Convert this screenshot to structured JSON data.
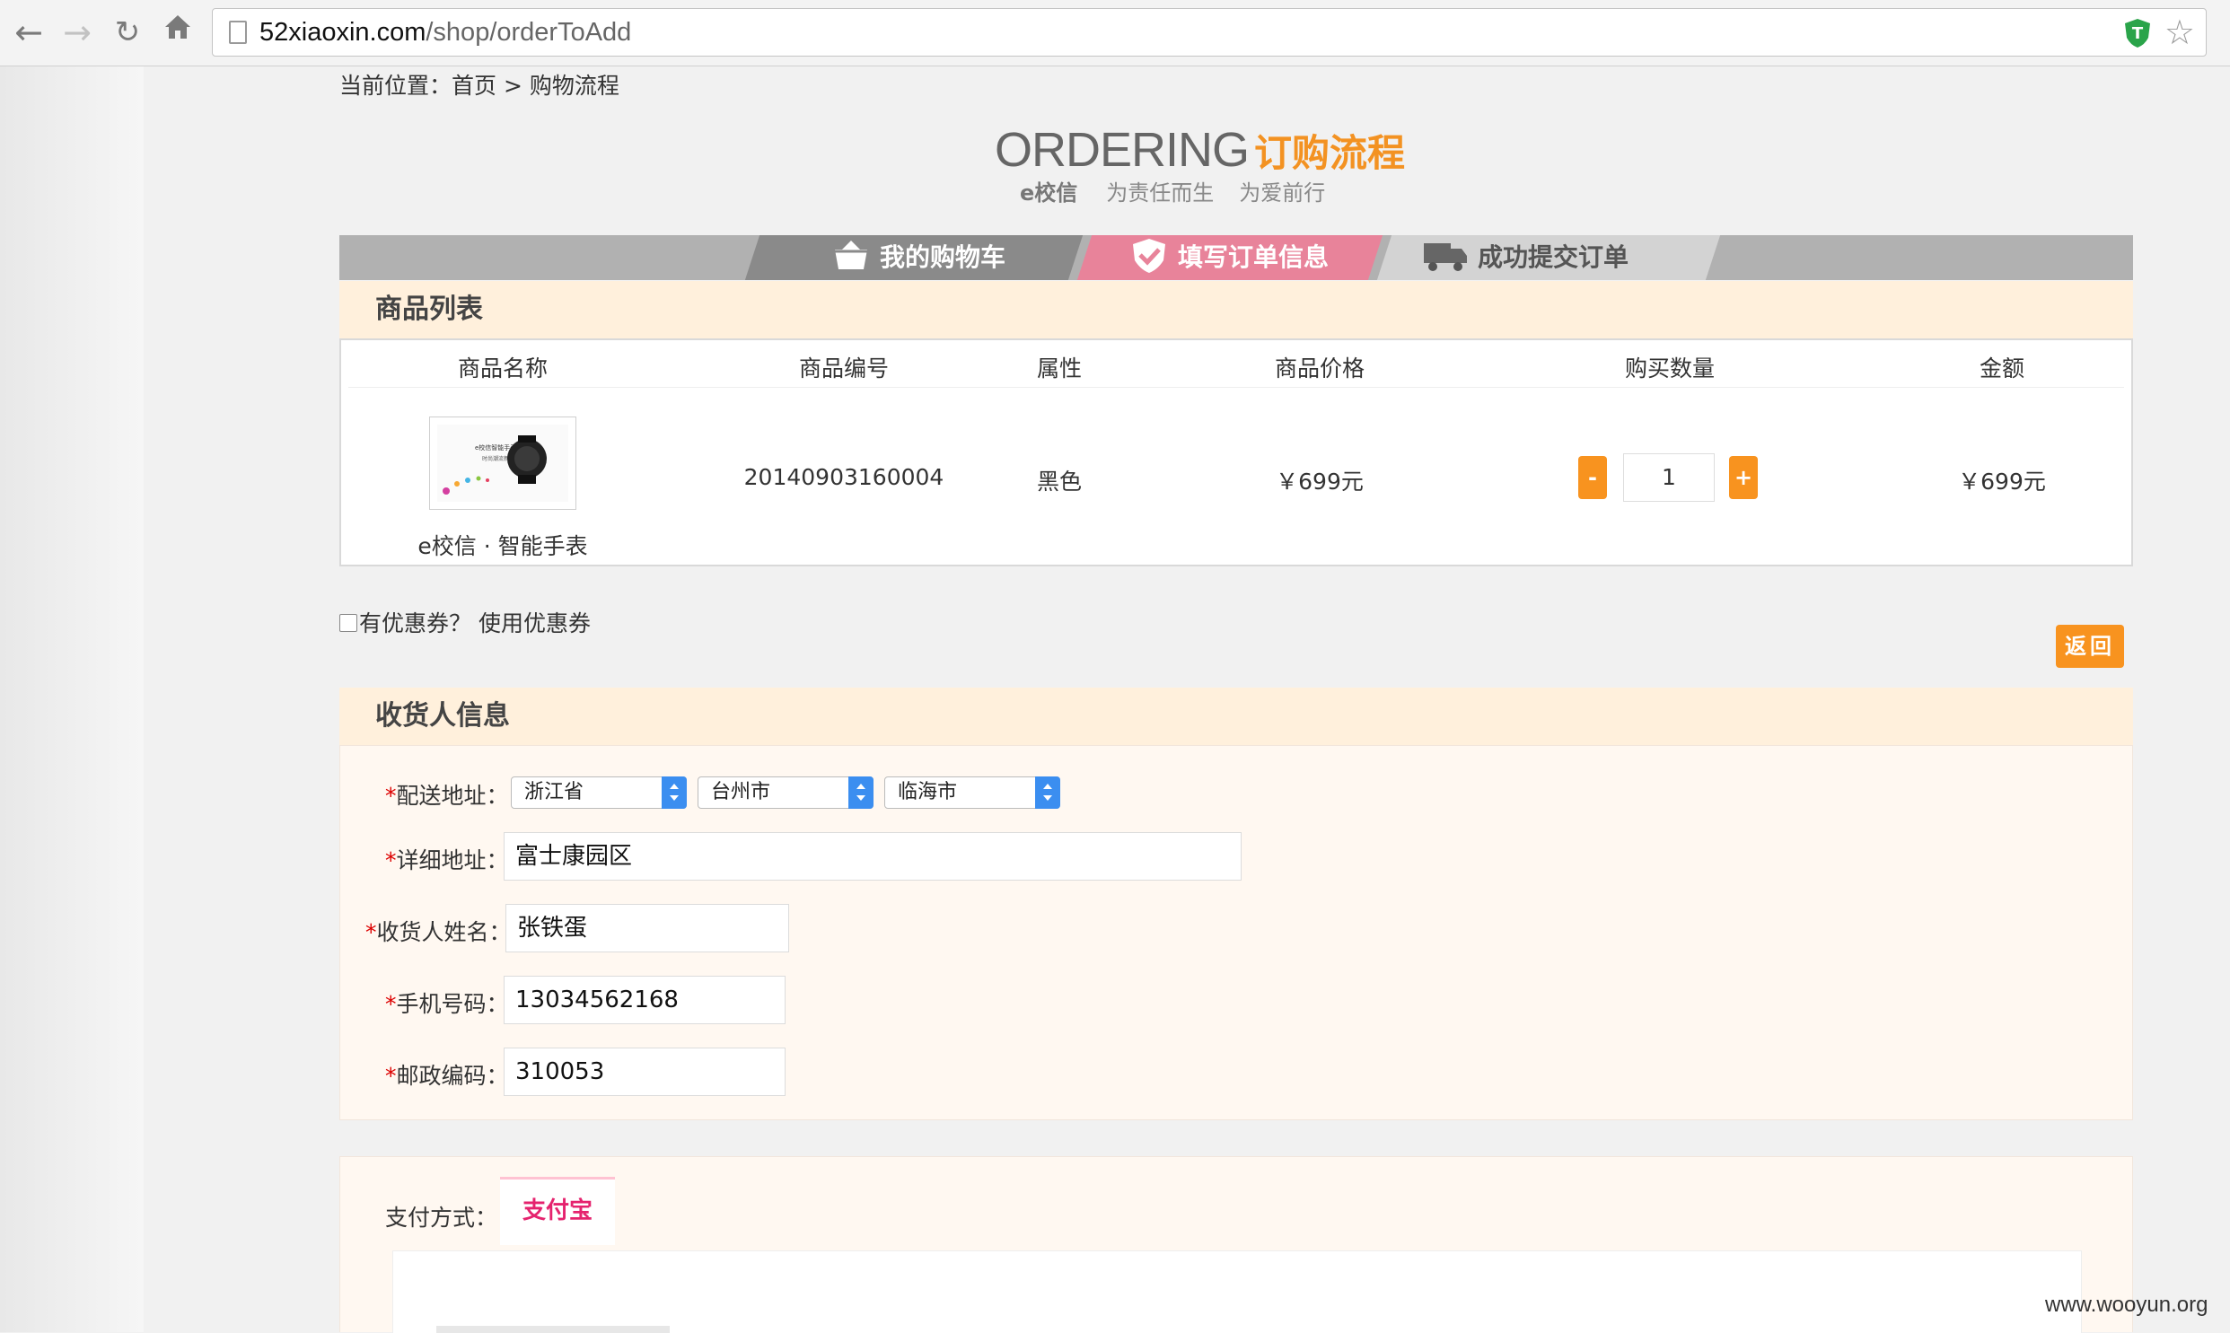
{
  "browser": {
    "url_host": "52xiaoxin.com",
    "url_path": "/shop/orderToAdd",
    "back_icon": "arrow-left-icon",
    "forward_icon": "arrow-right-icon",
    "reload_icon": "reload-icon",
    "home_icon": "home-icon",
    "extension_icon": "shield-extension-icon",
    "star_icon": "star-icon"
  },
  "breadcrumb": {
    "prefix": "当前位置：",
    "home": "首页",
    "separator": ">",
    "current": "购物流程"
  },
  "heading": {
    "title_en": "ORDERING",
    "title_cn": "订购流程",
    "brand": "e校信",
    "slogan1": "为责任而生",
    "slogan2": "为爱前行"
  },
  "steps": [
    {
      "label": "我的购物车",
      "icon": "basket-icon",
      "state": "done"
    },
    {
      "label": "填写订单信息",
      "icon": "check-shield-icon",
      "state": "active"
    },
    {
      "label": "成功提交订单",
      "icon": "truck-icon",
      "state": "pending"
    }
  ],
  "goods": {
    "section_title": "商品列表",
    "headers": [
      "商品名称",
      "商品编号",
      "属性",
      "商品价格",
      "购买数量",
      "金额"
    ],
    "rows": [
      {
        "name": "e校信 · 智能手表",
        "code": "20140903160004",
        "attr": "黑色",
        "price": "￥699元",
        "qty": "1",
        "total": "￥699元"
      }
    ],
    "minus_label": "-",
    "plus_label": "+"
  },
  "coupon": {
    "label": "有优惠券？ 使用优惠券",
    "checked": false
  },
  "back_button": "返回",
  "receiver": {
    "section_title": "收货人信息",
    "address_label": "配送地址：",
    "province": "浙江省",
    "city": "台州市",
    "district": "临海市",
    "detail_label": "详细地址：",
    "detail_value": "富士康园区",
    "name_label": "收货人姓名：",
    "name_value": "张铁蛋",
    "phone_label": "手机号码：",
    "phone_value": "13034562168",
    "zip_label": "邮政编码：",
    "zip_value": "310053",
    "required_mark": "*"
  },
  "payment": {
    "label": "支付方式：",
    "tab": "支付宝Alipy"
  },
  "watermark": "www.wooyun.org",
  "colors": {
    "accent_orange": "#f8931f",
    "active_step_pink": "#e8839a",
    "section_bg": "#fff0dc",
    "alipay_text": "#e5236e"
  }
}
